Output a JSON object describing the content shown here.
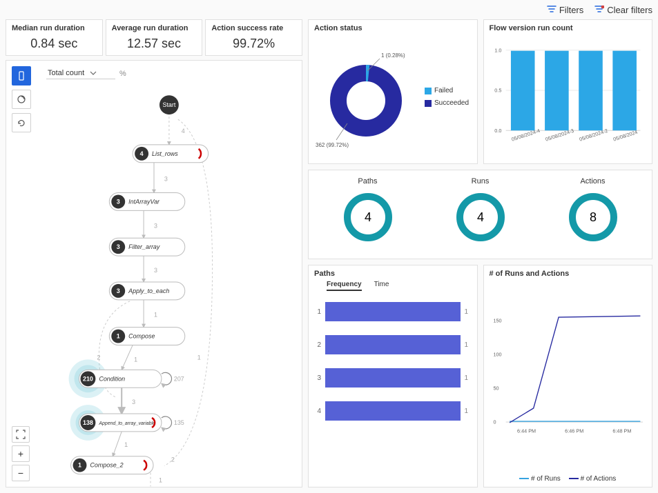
{
  "toolbar": {
    "filters": "Filters",
    "clear": "Clear filters"
  },
  "kpis": {
    "median_label": "Median run duration",
    "median_value": "0.84 sec",
    "avg_label": "Average run duration",
    "avg_value": "12.57 sec",
    "success_label": "Action success rate",
    "success_value": "99.72%"
  },
  "flow": {
    "dropdown_label": "Total count",
    "pct_label": "%",
    "start": "Start",
    "nodes": [
      {
        "n": "4",
        "label": "List_rows"
      },
      {
        "n": "3",
        "label": "IntArrayVar"
      },
      {
        "n": "3",
        "label": "Filter_array"
      },
      {
        "n": "3",
        "label": "Apply_to_each"
      },
      {
        "n": "1",
        "label": "Compose"
      },
      {
        "n": "210",
        "label": "Condition"
      },
      {
        "n": "138",
        "label": "Append_to_array_variable"
      },
      {
        "n": "1",
        "label": "Compose_2"
      }
    ],
    "edge_labels": [
      "4",
      "3",
      "3",
      "3",
      "1",
      "1",
      "3",
      "1",
      "1",
      "2",
      "2",
      "207",
      "135",
      "1"
    ]
  },
  "donut": {
    "title": "Action status",
    "series": [
      {
        "name": "Failed",
        "value": 1,
        "pct": "0.28%",
        "color": "#2ca7e6"
      },
      {
        "name": "Succeeded",
        "value": 362,
        "pct": "99.72%",
        "color": "#272aa0"
      }
    ],
    "label_top": "1 (0.28%)",
    "label_bottom": "362 (99.72%)"
  },
  "chart_data": [
    {
      "type": "pie",
      "title": "Action status",
      "series": [
        {
          "name": "Failed",
          "value": 1
        },
        {
          "name": "Succeeded",
          "value": 362
        }
      ]
    },
    {
      "type": "bar",
      "title": "Flow version run count",
      "categories": [
        "05/08/2024-4",
        "05/08/2024-3",
        "05/08/2024-2",
        "05/08/2024"
      ],
      "values": [
        1.0,
        1.0,
        1.0,
        1.0
      ],
      "ylim": [
        0.0,
        1.0
      ]
    },
    {
      "type": "bar",
      "title": "Paths — Frequency",
      "categories": [
        "1",
        "2",
        "3",
        "4"
      ],
      "values": [
        1,
        1,
        1,
        1
      ]
    },
    {
      "type": "line",
      "title": "# of Runs and Actions",
      "x": [
        "6:44 PM",
        "6:46 PM",
        "6:48 PM"
      ],
      "series": [
        {
          "name": "# of Runs",
          "values": [
            1,
            1,
            1
          ]
        },
        {
          "name": "# of Actions",
          "values": [
            0,
            170,
            170
          ]
        }
      ],
      "ylim": [
        0,
        170
      ]
    }
  ],
  "version_bar": {
    "title": "Flow version run count",
    "ticks_y": [
      "0.0",
      "0.5",
      "1.0"
    ],
    "categories": [
      "05/08/2024-4",
      "05/08/2024-3",
      "05/08/2024-2",
      "05/08/2024"
    ]
  },
  "rings": {
    "paths_label": "Paths",
    "paths_val": "4",
    "runs_label": "Runs",
    "runs_val": "4",
    "actions_label": "Actions",
    "actions_val": "8"
  },
  "paths_panel": {
    "title": "Paths",
    "tab_freq": "Frequency",
    "tab_time": "Time",
    "rows": [
      {
        "idx": "1",
        "val": "1"
      },
      {
        "idx": "2",
        "val": "1"
      },
      {
        "idx": "3",
        "val": "1"
      },
      {
        "idx": "4",
        "val": "1"
      }
    ]
  },
  "line_panel": {
    "title": "# of Runs and Actions",
    "y_ticks": [
      "0",
      "50",
      "100",
      "150"
    ],
    "x_ticks": [
      "6:44 PM",
      "6:46 PM",
      "6:48 PM"
    ],
    "legend_runs": "# of Runs",
    "legend_actions": "# of Actions"
  }
}
